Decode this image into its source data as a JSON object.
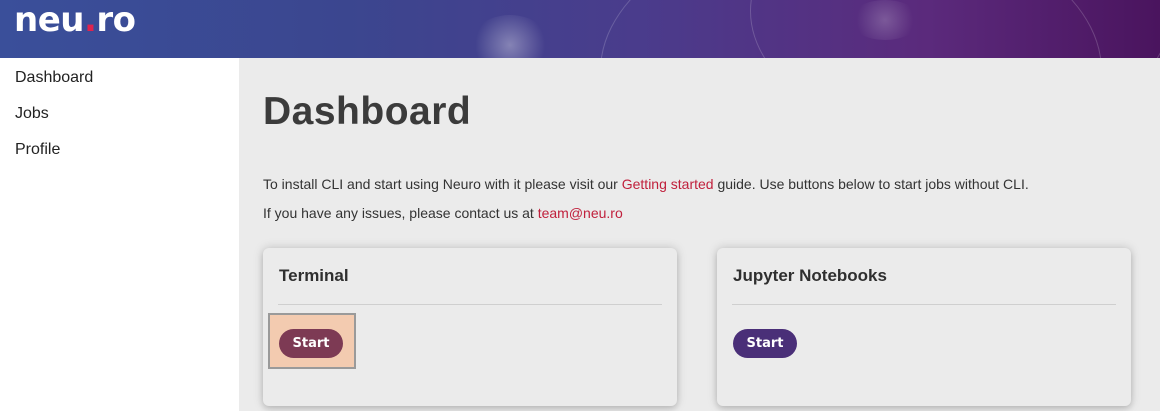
{
  "header": {
    "logo_part1": "neu",
    "logo_dot": ".",
    "logo_part2": "ro"
  },
  "sidebar": {
    "items": [
      {
        "label": "Dashboard"
      },
      {
        "label": "Jobs"
      },
      {
        "label": "Profile"
      }
    ]
  },
  "main": {
    "title": "Dashboard",
    "intro": {
      "before_link": "To install CLI and start using Neuro with it please visit our ",
      "link": "Getting started",
      "after_link": " guide. Use buttons below to start jobs without CLI."
    },
    "contact": {
      "text": "If you have any issues, please contact us at ",
      "email": "team@neu.ro"
    },
    "cards": [
      {
        "title": "Terminal",
        "button_label": "Start",
        "button_color": "#7d3a54"
      },
      {
        "title": "Jupyter Notebooks",
        "button_label": "Start",
        "button_color": "#4a2f78"
      }
    ]
  },
  "colors": {
    "accent_link": "#c0203c",
    "logo_dot": "#e0234e"
  }
}
